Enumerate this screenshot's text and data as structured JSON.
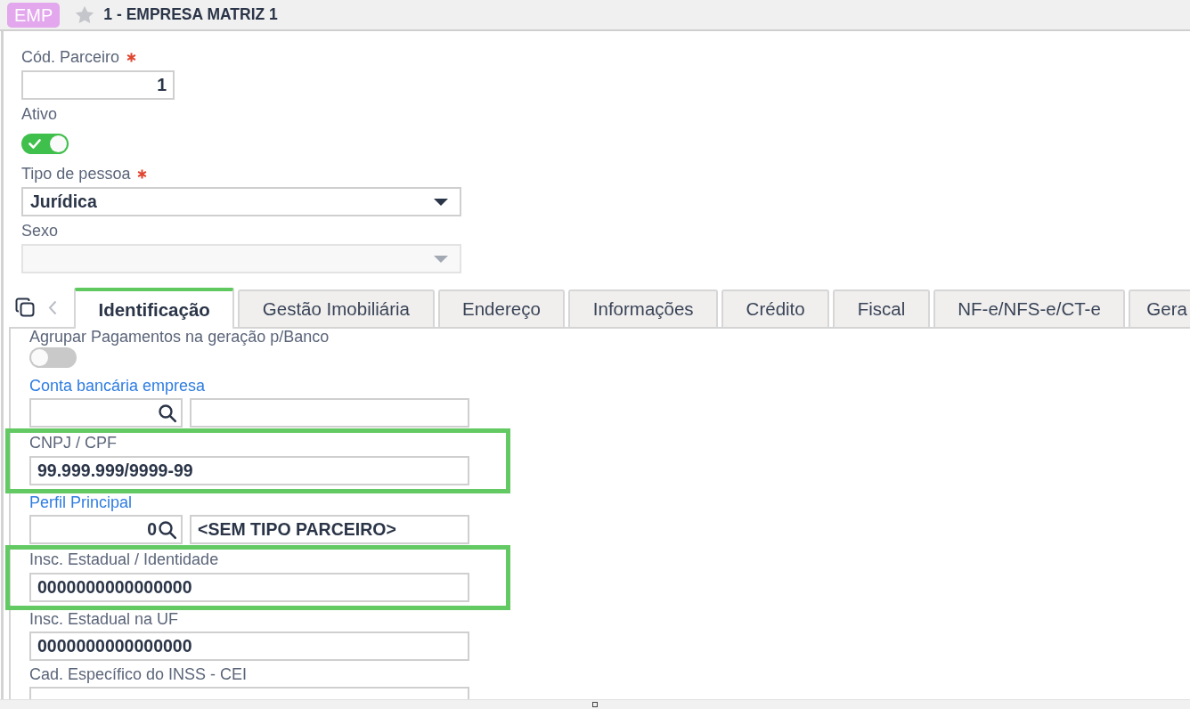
{
  "header": {
    "badge": "EMP",
    "favorite": false,
    "title": "1 - EMPRESA MATRIZ 1"
  },
  "form": {
    "fields": [
      {
        "kind": "number",
        "label": "Cód. Parceiro",
        "required": true,
        "value": "1"
      },
      {
        "kind": "toggle",
        "label": "Ativo",
        "required": false,
        "on": true
      },
      {
        "kind": "select",
        "label": "Tipo de pessoa",
        "required": true,
        "disabled": false,
        "value": "Jurídica"
      },
      {
        "kind": "select",
        "label": "Sexo",
        "required": false,
        "disabled": true
      }
    ]
  },
  "tabs": [
    {
      "label": "Identificação",
      "selected": true
    },
    {
      "label": "Gestão Imobiliária",
      "selected": false
    },
    {
      "label": "Endereço",
      "selected": false
    },
    {
      "label": "Informações",
      "selected": false
    },
    {
      "label": "Crédito",
      "selected": false
    },
    {
      "label": "Fiscal",
      "selected": false
    },
    {
      "label": "NF-e/NFS-e/CT-e",
      "selected": false
    },
    {
      "label": "Gera",
      "selected": false
    }
  ],
  "tab_panel": {
    "fields": [
      {
        "kind": "toggle",
        "label": "Agrupar Pagamentos na geração p/Banco",
        "on": false
      },
      {
        "kind": "lookup",
        "label": "Conta bancária empresa"
      },
      {
        "kind": "text",
        "label": "CNPJ / CPF",
        "value": "99.999.999/9999-99",
        "highlighted": true
      },
      {
        "kind": "lookup",
        "label": "Perfil Principal",
        "code": "0",
        "description": "<SEM TIPO PARCEIRO>"
      },
      {
        "kind": "text",
        "label": "Insc. Estadual / Identidade",
        "value": "0000000000000000",
        "highlighted": true
      },
      {
        "kind": "text",
        "label": "Insc. Estadual na UF",
        "value": "0000000000000000",
        "highlighted": false
      },
      {
        "kind": "text",
        "label": "Cad. Específico do INSS - CEI",
        "highlighted": false
      }
    ]
  }
}
